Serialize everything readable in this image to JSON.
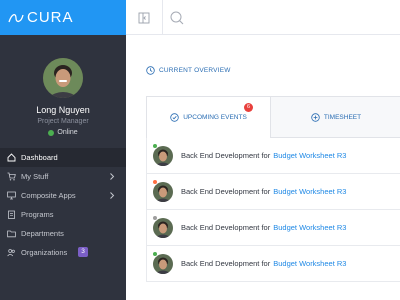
{
  "brand": {
    "name": "CURA",
    "color": "#2196f3"
  },
  "profile": {
    "name": "Long Nguyen",
    "role": "Project Manager",
    "status": "Online",
    "status_color": "#4caf50"
  },
  "nav": {
    "items": [
      {
        "label": "Dashboard",
        "icon": "home-icon",
        "active": true
      },
      {
        "label": "My Stuff",
        "icon": "cart-icon",
        "has_chevron": true
      },
      {
        "label": "Composite Apps",
        "icon": "monitor-icon",
        "has_chevron": true
      },
      {
        "label": "Programs",
        "icon": "clipboard-icon"
      },
      {
        "label": "Departments",
        "icon": "folder-icon"
      },
      {
        "label": "Organizations",
        "icon": "users-icon",
        "badge": "3"
      }
    ]
  },
  "topbar": {
    "split_icon": "split-panel-icon",
    "search_icon": "search-icon"
  },
  "main": {
    "section_title": "CURRENT OVERVIEW",
    "tabs": [
      {
        "label": "UPCOMING EVENTS",
        "icon": "check-circle-icon",
        "badge": "6",
        "active": true
      },
      {
        "label": "TIMESHEET",
        "icon": "plus-circle-icon",
        "active": false
      }
    ],
    "events": [
      {
        "text": "Back End Development for",
        "link": "Budget Worksheet R3",
        "status_color": "#4caf50"
      },
      {
        "text": "Back End Development for",
        "link": "Budget Worksheet R3",
        "status_color": "#ff7043"
      },
      {
        "text": "Back End Development for",
        "link": "Budget Worksheet R3",
        "status_color": "#9e9e9e"
      },
      {
        "text": "Back End Development for",
        "link": "Budget Worksheet R3",
        "status_color": "#4caf50"
      }
    ]
  },
  "colors": {
    "accent": "#2196f3",
    "sidebar": "#2f333e",
    "badge_red": "#e8403c",
    "badge_purple": "#7b5fc6"
  }
}
